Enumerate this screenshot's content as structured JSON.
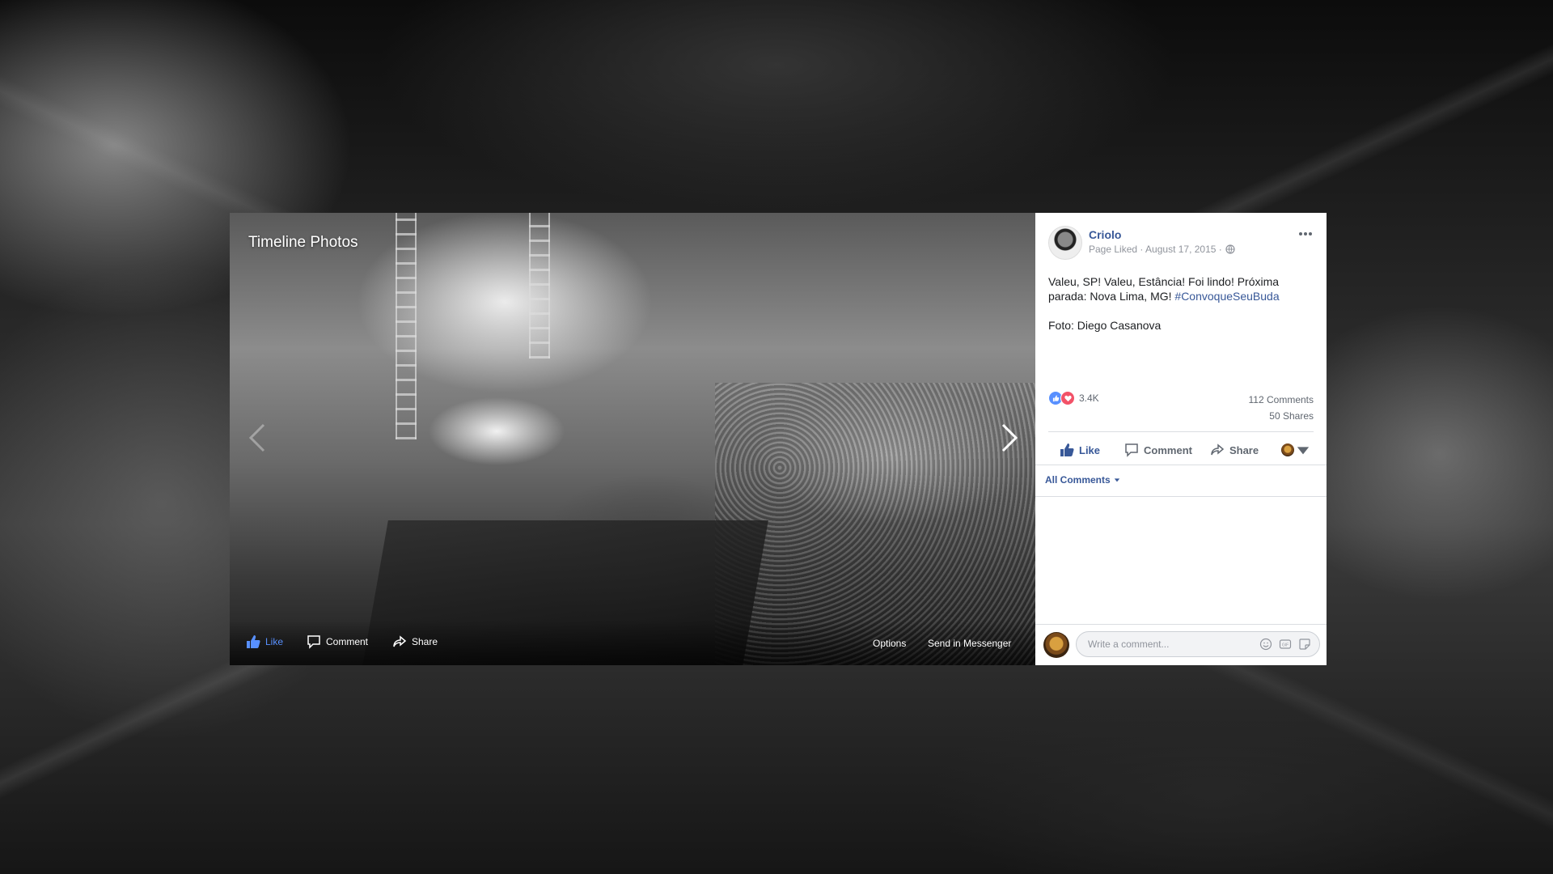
{
  "viewer": {
    "title": "Timeline Photos",
    "actions": {
      "like": "Like",
      "comment": "Comment",
      "share": "Share",
      "options": "Options",
      "send_in_messenger": "Send in Messenger"
    }
  },
  "post": {
    "author": "Criolo",
    "meta": "Page Liked · August 17, 2015 · ",
    "body_line1": "Valeu, SP! Valeu, Estância! Foi lindo! Próxima parada: Nova Lima, MG! ",
    "hashtag": "#ConvoqueSeuBuda",
    "body_line2": "Foto: Diego Casanova",
    "reaction_count": "3.4K",
    "comments_count": "112 Comments",
    "shares_count": "50 Shares"
  },
  "actions": {
    "like": "Like",
    "comment": "Comment",
    "share": "Share"
  },
  "comments": {
    "filter": "All Comments",
    "placeholder": "Write a comment..."
  },
  "colors": {
    "link": "#385898",
    "like_blue": "#5890ff",
    "love_red": "#f25268"
  }
}
